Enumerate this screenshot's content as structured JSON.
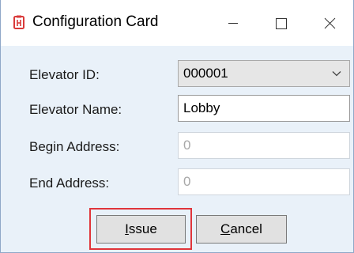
{
  "window": {
    "title": "Configuration Card",
    "icon": "app-logo-icon",
    "controls": {
      "minimize": "minimize-icon",
      "maximize": "maximize-icon",
      "close": "close-icon"
    }
  },
  "form": {
    "elevator_id": {
      "label": "Elevator ID:",
      "value": "000001"
    },
    "elevator_name": {
      "label": "Elevator Name:",
      "value": "Lobby"
    },
    "begin_address": {
      "label": "Begin Address:",
      "value": "0"
    },
    "end_address": {
      "label": "End Address:",
      "value": "0"
    }
  },
  "buttons": {
    "issue": {
      "mnemonic": "I",
      "rest": "ssue"
    },
    "cancel": {
      "mnemonic": "C",
      "rest": "ancel"
    }
  },
  "colors": {
    "highlight": "#e0353b",
    "client_bg": "#e9f1f9",
    "app_icon": "#d93a3a"
  }
}
